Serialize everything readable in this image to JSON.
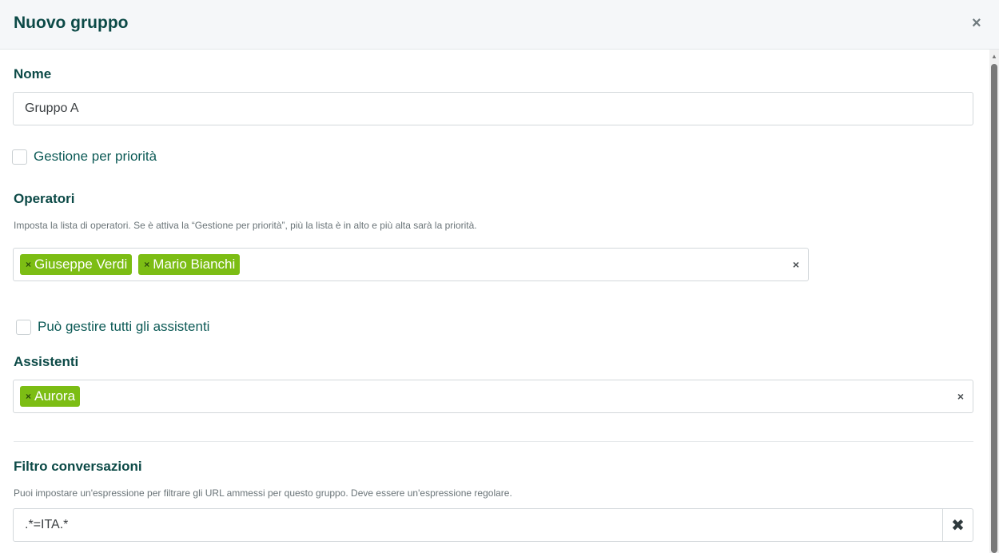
{
  "dialog": {
    "title": "Nuovo gruppo",
    "close_icon": "close-icon"
  },
  "name_field": {
    "label": "Nome",
    "value": "Gruppo A"
  },
  "priority_checkbox": {
    "label": "Gestione per priorità",
    "checked": false
  },
  "operators": {
    "label": "Operatori",
    "help": "Imposta la lista di operatori. Se è attiva la “Gestione per priorità”, più la lista è in alto e più alta sarà la priorità.",
    "tags": [
      "Giuseppe Verdi",
      "Mario Bianchi"
    ],
    "tag_remove_glyph": "×",
    "clear_glyph": "×"
  },
  "all_assistants_checkbox": {
    "label": "Può gestire tutti gli assistenti",
    "checked": false
  },
  "assistants": {
    "label": "Assistenti",
    "tags": [
      "Aurora"
    ],
    "tag_remove_glyph": "×",
    "clear_glyph": "×"
  },
  "filter": {
    "label": "Filtro conversazioni",
    "help": "Puoi impostare un'espressione per filtrare gli URL ammessi per questo gruppo. Deve essere un'espressione regolare.",
    "value": ".*=ITA.*",
    "clear_glyph": "✖"
  },
  "colors": {
    "tag_bg": "#7cbd14",
    "heading": "#0c4a47"
  }
}
